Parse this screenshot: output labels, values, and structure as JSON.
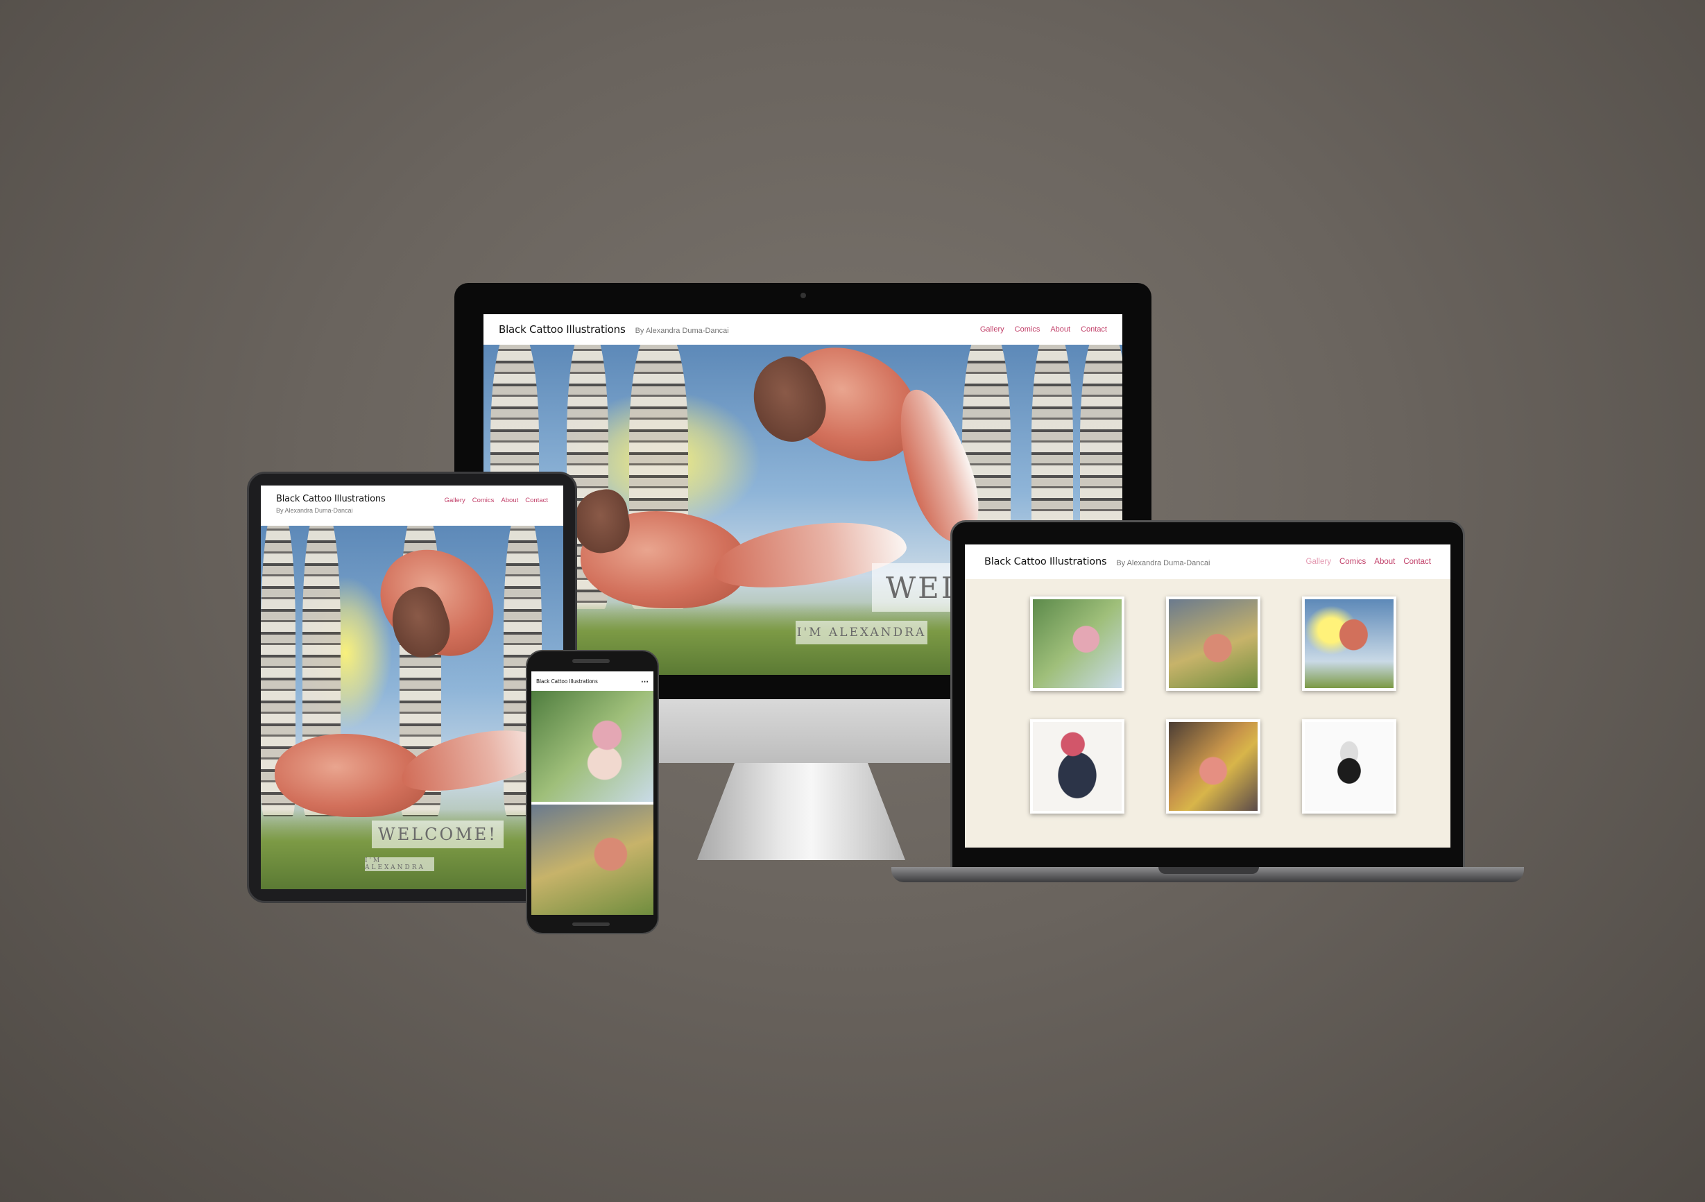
{
  "site": {
    "title": "Black Cattoo Illustrations",
    "subtitle": "By Alexandra Duma-Dancai",
    "nav": [
      "Gallery",
      "Comics",
      "About",
      "Contact"
    ],
    "hero_welcome": "WELCOME!",
    "hero_welcome_partial": "WELC",
    "hero_intro": "I'M ALEXANDRA",
    "accent_color": "#c2416a"
  },
  "phone": {
    "title": "Black Cattoo Illustrations",
    "menu_icon": "ellipsis-icon"
  }
}
